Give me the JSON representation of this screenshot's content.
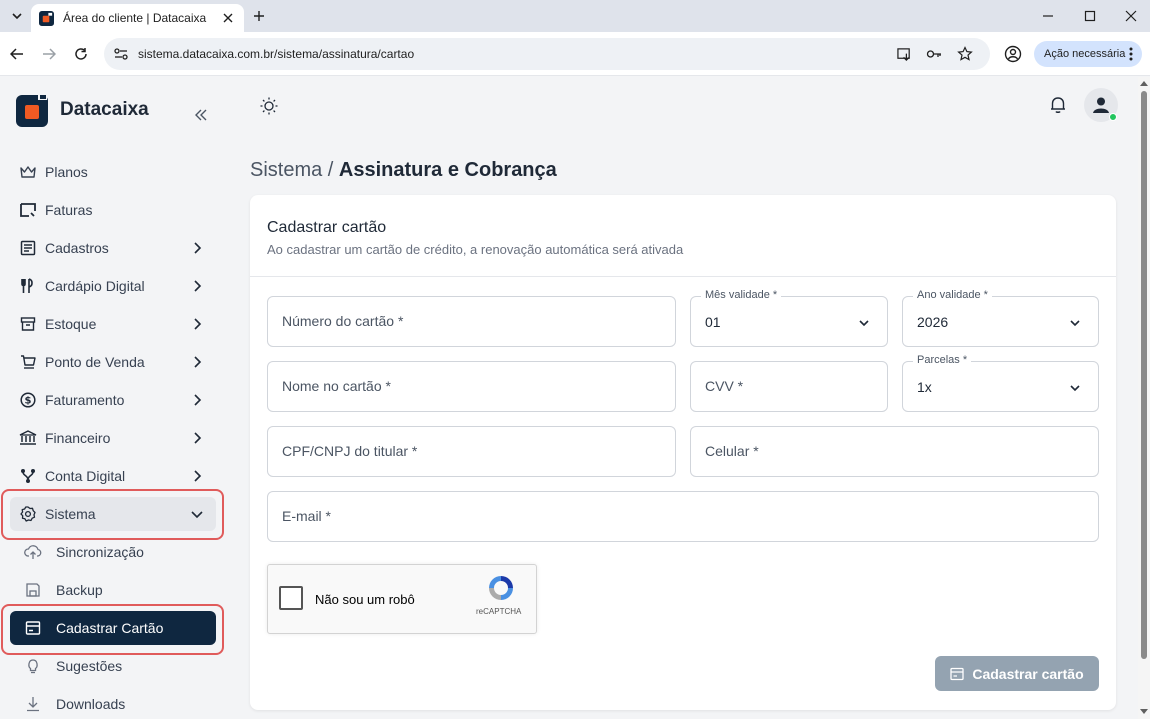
{
  "browser": {
    "tab_title": "Área do cliente | Datacaixa",
    "url": "sistema.datacaixa.com.br/sistema/assinatura/cartao",
    "action_label": "Ação necessária"
  },
  "sidebar": {
    "brand": "Datacaixa",
    "items": [
      {
        "label": "Planos",
        "icon": "crown-icon"
      },
      {
        "label": "Faturas",
        "icon": "invoice-icon"
      },
      {
        "label": "Cadastros",
        "icon": "list-icon"
      },
      {
        "label": "Cardápio Digital",
        "icon": "utensils-icon"
      },
      {
        "label": "Estoque",
        "icon": "box-icon"
      },
      {
        "label": "Ponto de Venda",
        "icon": "cart-icon"
      },
      {
        "label": "Faturamento",
        "icon": "dollar-circle-icon"
      },
      {
        "label": "Financeiro",
        "icon": "bank-icon"
      },
      {
        "label": "Conta Digital",
        "icon": "branch-icon"
      },
      {
        "label": "Sistema",
        "icon": "gear-icon"
      }
    ],
    "subitems": [
      {
        "label": "Sincronização",
        "icon": "cloud-upload-icon"
      },
      {
        "label": "Backup",
        "icon": "save-icon"
      },
      {
        "label": "Cadastrar Cartão",
        "icon": "credit-card-icon"
      },
      {
        "label": "Sugestões",
        "icon": "lightbulb-icon"
      },
      {
        "label": "Downloads",
        "icon": "download-icon"
      }
    ]
  },
  "main": {
    "breadcrumb_root": "Sistema / ",
    "breadcrumb_current": "Assinatura e Cobrança",
    "card": {
      "title": "Cadastrar cartão",
      "subtitle": "Ao cadastrar um cartão de crédito, a renovação automática será ativada"
    },
    "form": {
      "card_number": "Número do cartão *",
      "month_label": "Mês validade *",
      "month_value": "01",
      "year_label": "Ano validade *",
      "year_value": "2026",
      "holder_name": "Nome no cartão *",
      "cvv": "CVV *",
      "installments_label": "Parcelas *",
      "installments_value": "1x",
      "document": "CPF/CNPJ do titular *",
      "phone": "Celular *",
      "email": "E-mail *"
    },
    "captcha": {
      "label": "Não sou um robô",
      "brand": "reCAPTCHA"
    },
    "submit_label": "Cadastrar cartão"
  },
  "colors": {
    "sidebar_selected": "#0f2740",
    "highlight": "#e05b5b",
    "submit_disabled": "#94a3b1",
    "brand_orange": "#f05a23"
  }
}
